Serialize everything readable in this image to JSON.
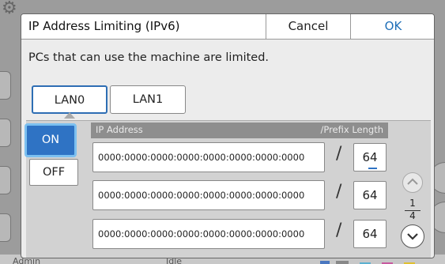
{
  "dialog": {
    "title": "IP Address Limiting (IPv6)",
    "cancel_label": "Cancel",
    "ok_label": "OK",
    "info": "PCs that can use the machine are limited."
  },
  "lan_tabs": [
    {
      "label": "LAN0",
      "selected": true
    },
    {
      "label": "LAN1",
      "selected": false
    }
  ],
  "toggle": {
    "on_label": "ON",
    "off_label": "OFF",
    "value": "ON"
  },
  "table": {
    "header_ip": "IP Address",
    "header_prefix": "/Prefix Length",
    "separator": "/",
    "rows": [
      {
        "ip": "0000:0000:0000:0000:0000:0000:0000:0000",
        "prefix": "64"
      },
      {
        "ip": "0000:0000:0000:0000:0000:0000:0000:0000",
        "prefix": "64"
      },
      {
        "ip": "0000:0000:0000:0000:0000:0000:0000:0000",
        "prefix": "64"
      }
    ]
  },
  "pager": {
    "current": "1",
    "total": "4"
  },
  "status_bar": {
    "user": "Admin",
    "state": "Idle"
  },
  "colors": {
    "accent": "#2f73c4",
    "ok_text": "#1f6fb8",
    "focus_ring": "#7cc0f0"
  }
}
